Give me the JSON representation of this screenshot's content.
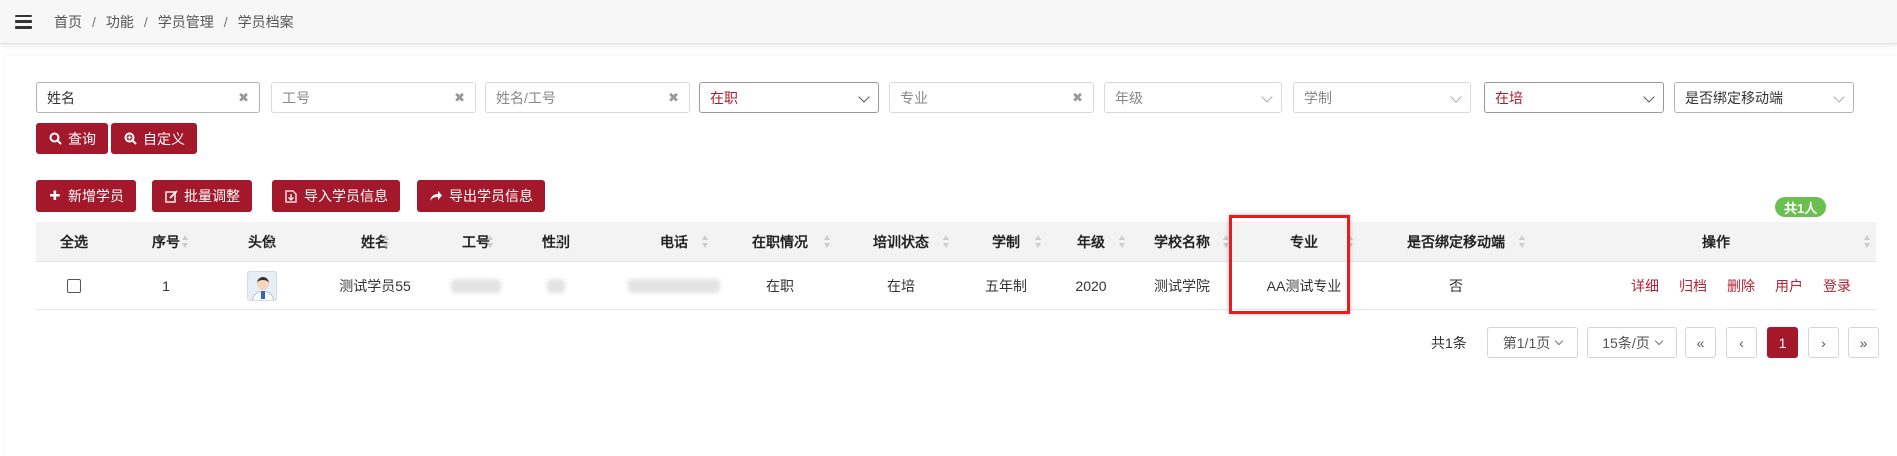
{
  "breadcrumb": [
    "首页",
    "功能",
    "学员管理",
    "学员档案"
  ],
  "filters": {
    "name_placeholder": "姓名",
    "job_no_placeholder": "工号",
    "name_or_no_placeholder": "姓名/工号",
    "employment_value": "在职",
    "major_placeholder": "专业",
    "grade_placeholder": "年级",
    "program_placeholder": "学制",
    "training_value": "在培",
    "mobile_bind_placeholder": "是否绑定移动端"
  },
  "buttons": {
    "search": "查询",
    "custom": "自定义",
    "add": "新增学员",
    "batch": "批量调整",
    "import": "导入学员信息",
    "export": "导出学员信息"
  },
  "total_badge": "共1人",
  "table": {
    "headers": [
      "全选",
      "序号",
      "头像",
      "姓名",
      "工号",
      "性别",
      "电话",
      "在职情况",
      "培训状态",
      "学制",
      "年级",
      "学校名称",
      "专业",
      "是否绑定移动端",
      "操作"
    ],
    "rows": [
      {
        "index": "1",
        "name": "测试学员55",
        "employment": "在职",
        "training": "在培",
        "program": "五年制",
        "grade": "2020",
        "school": "测试学院",
        "major": "AA测试专业",
        "mobile_bound": "否",
        "actions": [
          "详细",
          "归档",
          "删除",
          "用户",
          "登录"
        ]
      }
    ]
  },
  "pagination": {
    "total": "共1条",
    "page_select": "第1/1页",
    "size_select": "15条/页",
    "first": "«",
    "prev": "‹",
    "current": "1",
    "next": "›",
    "last": "»"
  },
  "colors": {
    "accent": "#a3192b",
    "badge": "#6bbf4e",
    "highlight": "#e02020"
  }
}
